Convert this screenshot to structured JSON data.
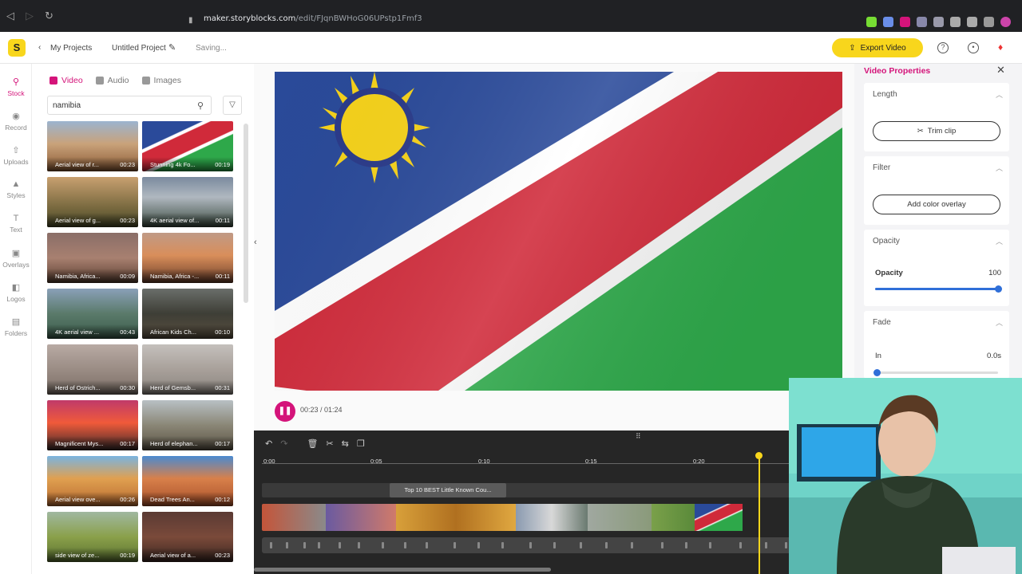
{
  "browser": {
    "url_host": "maker.storyblocks.com",
    "url_path": "/edit/FJqnBWHoG06UPstp1Fmf3"
  },
  "header": {
    "logo": "S",
    "back_label": "My Projects",
    "project_name": "Untitled Project",
    "status": "Saving...",
    "export_label": "Export Video"
  },
  "rail": [
    {
      "label": "Stock",
      "icon": "search-icon"
    },
    {
      "label": "Record",
      "icon": "record-icon"
    },
    {
      "label": "Uploads",
      "icon": "upload-icon"
    },
    {
      "label": "Styles",
      "icon": "styles-icon"
    },
    {
      "label": "Text",
      "icon": "text-icon"
    },
    {
      "label": "Overlays",
      "icon": "overlays-icon"
    },
    {
      "label": "Logos",
      "icon": "logos-icon"
    },
    {
      "label": "Folders",
      "icon": "folder-icon"
    }
  ],
  "media": {
    "tabs": [
      "Video",
      "Audio",
      "Images"
    ],
    "search_value": "namibia",
    "tiles": [
      {
        "title": "Aerial view of r...",
        "duration": "00:23"
      },
      {
        "title": "Stunning 4k Fo...",
        "duration": "00:19"
      },
      {
        "title": "Aerial view of g...",
        "duration": "00:23"
      },
      {
        "title": "4K aerial view of...",
        "duration": "00:11"
      },
      {
        "title": "Namibia, Africa...",
        "duration": "00:09"
      },
      {
        "title": "Namibia, Africa -...",
        "duration": "00:11"
      },
      {
        "title": "4K aerial view ...",
        "duration": "00:43"
      },
      {
        "title": "African Kids Ch...",
        "duration": "00:10"
      },
      {
        "title": "Herd of Ostrich...",
        "duration": "00:30"
      },
      {
        "title": "Herd of Gemsb...",
        "duration": "00:31"
      },
      {
        "title": "Magnificent Mys...",
        "duration": "00:17"
      },
      {
        "title": "Herd of elephan...",
        "duration": "00:17"
      },
      {
        "title": "Aerial view ove...",
        "duration": "00:26"
      },
      {
        "title": "Dead Trees An...",
        "duration": "00:12"
      },
      {
        "title": "side view of ze...",
        "duration": "00:19"
      },
      {
        "title": "Aerial view of a...",
        "duration": "00:23"
      }
    ]
  },
  "player": {
    "time": "00:23 / 01:24"
  },
  "timeline": {
    "ticks": [
      "0:00",
      "0:05",
      "0:10",
      "0:15",
      "0:20"
    ],
    "track_title": "Top 10 BEST Little Known Cou..."
  },
  "properties": {
    "title": "Video Properties",
    "length_label": "Length",
    "trim_label": "Trim clip",
    "filter_label": "Filter",
    "overlay_label": "Add color overlay",
    "opacity_section": "Opacity",
    "opacity_label": "Opacity",
    "opacity_value": "100",
    "fade_label": "Fade",
    "fade_in_label": "In",
    "fade_in_value": "0.0s"
  },
  "colors": {
    "accent": "#d4147a",
    "export": "#f8d61c",
    "slider": "#2f6fd8"
  }
}
